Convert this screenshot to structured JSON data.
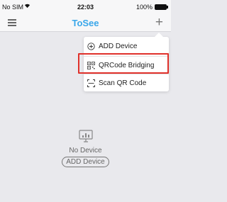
{
  "status_bar": {
    "carrier": "No SIM",
    "time": "22:03",
    "battery": "100%"
  },
  "nav": {
    "title": "ToSee"
  },
  "menu": {
    "items": [
      {
        "label": "ADD Device",
        "icon": "add-circle-icon"
      },
      {
        "label": "QRCode Bridging",
        "icon": "qr-code-icon"
      },
      {
        "label": "Scan QR Code",
        "icon": "scan-icon"
      }
    ],
    "highlighted": "QRCode Bridging",
    "highlight_color": "#e0312b"
  },
  "empty_state": {
    "message": "No Device",
    "button": "ADD Device"
  },
  "colors": {
    "accent": "#3aa7ea",
    "background": "#e9e9ed"
  }
}
